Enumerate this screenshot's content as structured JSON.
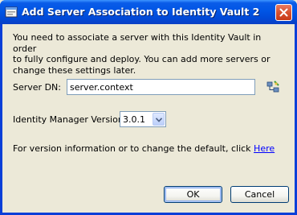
{
  "window": {
    "title": "Add Server Association to Identity Vault 2"
  },
  "description": {
    "line1": "You need to associate a server with this Identity Vault in order",
    "line2": "to fully configure and deploy.  You can add more servers or",
    "line3": "change these settings later."
  },
  "server_dn": {
    "label": "Server DN:",
    "value": "server.context"
  },
  "idm_version": {
    "label": "Identity Manager Version:",
    "selected": "3.0.1"
  },
  "version_info": {
    "text": "For version information or to change the default, click ",
    "link": "Here"
  },
  "buttons": {
    "ok": "OK",
    "cancel": "Cancel"
  },
  "icons": {
    "app": "dialog-app-icon",
    "close": "close-icon",
    "browse": "browse-tree-icon",
    "dropdown": "chevron-down-icon"
  },
  "colors": {
    "titlebar": "#0055e5",
    "close_button": "#d8512f",
    "dialog_bg": "#ece9d8",
    "link": "#0000ff"
  }
}
